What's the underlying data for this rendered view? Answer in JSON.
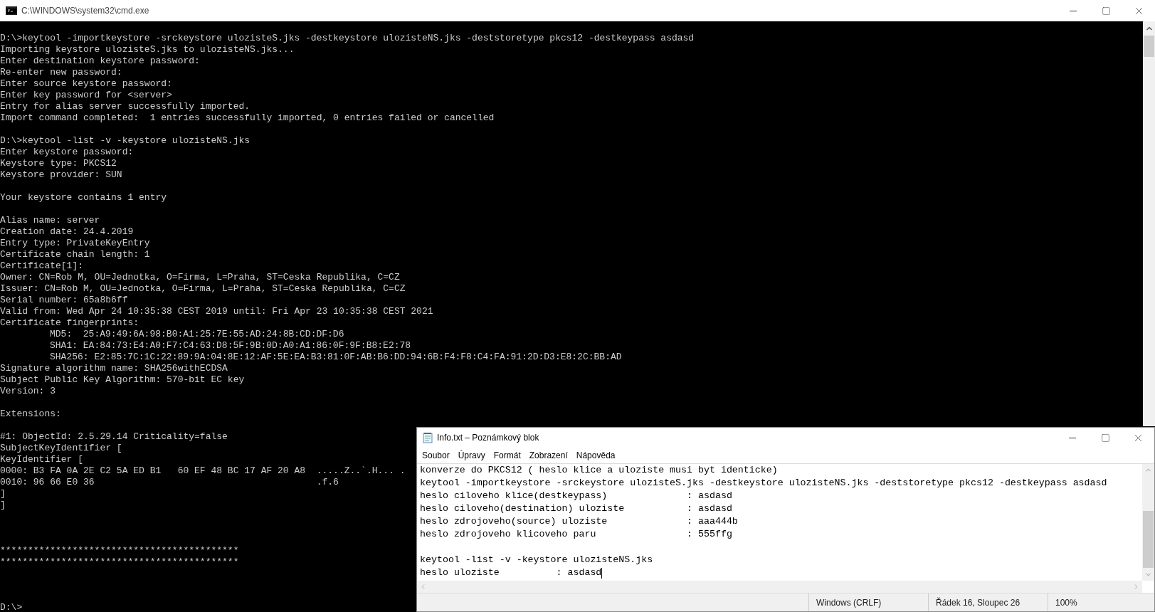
{
  "cmd": {
    "title": "C:\\WINDOWS\\system32\\cmd.exe",
    "blocks": [
      {
        "kind": "normal",
        "lines": [
          {
            "text": "D:\\>keytool -importkeystore -srckeystore ulozisteS.jks -destkeystore ulozisteNS.jks -deststoretype pkcs12 -destkeypass asdasd"
          },
          {
            "text": "Importing keystore ulozisteS.jks to ulozisteNS.jks..."
          },
          {
            "text": "Enter destination keystore password:"
          },
          {
            "text": "Re-enter new password:"
          },
          {
            "text": "Enter source keystore password:"
          },
          {
            "text": "Enter key password for <server>"
          },
          {
            "text": "Entry for alias server successfully imported."
          },
          {
            "text": "Import command completed:  1 entries successfully imported, 0 entries failed or cancelled"
          }
        ]
      },
      {
        "kind": "normal",
        "lines": [
          {
            "text": "D:\\>keytool -list -v -keystore ulozisteNS.jks"
          },
          {
            "text": "Enter keystore password:"
          },
          {
            "text": "Keystore type: PKCS12"
          },
          {
            "text": "Keystore provider: SUN"
          }
        ]
      },
      {
        "kind": "normal",
        "lines": [
          {
            "text": "Your keystore contains 1 entry"
          }
        ]
      },
      {
        "kind": "normal",
        "lines": [
          {
            "text": "Alias name: server"
          },
          {
            "text": "Creation date: 24.4.2019"
          },
          {
            "text": "Entry type: PrivateKeyEntry"
          },
          {
            "text": "Certificate chain length: 1"
          },
          {
            "text": "Certificate[1]:"
          },
          {
            "text": "Owner: CN=Rob M, OU=Jednotka, O=Firma, L=Praha, ST=Ceska Republika, C=CZ"
          },
          {
            "text": "Issuer: CN=Rob M, OU=Jednotka, O=Firma, L=Praha, ST=Ceska Republika, C=CZ"
          },
          {
            "text": "Serial number: 65a8b6ff"
          },
          {
            "text": "Valid from: Wed Apr 24 10:35:38 CEST 2019 until: Fri Apr 23 10:35:38 CEST 2021"
          },
          {
            "text": "Certificate fingerprints:",
            "children": [
              {
                "text": "MD5:  25:A9:49:6A:98:B0:A1:25:7E:55:AD:24:8B:CD:DF:D6"
              },
              {
                "text": "SHA1: EA:84:73:E4:A0:F7:C4:63:D8:5F:9B:0D:A0:A1:86:0F:9F:B8:E2:78"
              },
              {
                "text": "SHA256: E2:85:7C:1C:22:89:9A:04:8E:12:AF:5E:EA:B3:81:0F:AB:B6:DD:94:6B:F4:F8:C4:FA:91:2D:D3:E8:2C:BB:AD"
              }
            ]
          },
          {
            "text": "Signature algorithm name: SHA256withECDSA"
          },
          {
            "text": "Subject Public Key Algorithm: 570-bit EC key"
          },
          {
            "text": "Version: 3"
          }
        ]
      },
      {
        "kind": "normal",
        "lines": [
          {
            "text": "Extensions:"
          }
        ]
      },
      {
        "kind": "normal",
        "lines": [
          {
            "text": "#1: ObjectId: 2.5.29.14 Criticality=false"
          },
          {
            "text": "SubjectKeyIdentifier ["
          },
          {
            "text": "KeyIdentifier ["
          },
          {
            "text": "0000: B3 FA 0A 2E C2 5A ED B1   60 EF 48 BC 17 AF 20 A8  .....Z..`.H... ."
          },
          {
            "text": "0010: 96 66 E0 36                                        .f.6"
          },
          {
            "text": "]"
          },
          {
            "text": "]"
          }
        ]
      },
      {
        "kind": "wide",
        "lines": [
          {
            "text": "*******************************************"
          },
          {
            "text": "*******************************************"
          }
        ]
      },
      {
        "kind": "wide",
        "lines": [
          {
            "text": "D:\\>"
          }
        ]
      }
    ]
  },
  "notepad": {
    "title": "Info.txt – Poznámkový blok",
    "menu": [
      "Soubor",
      "Úpravy",
      "Formát",
      "Zobrazení",
      "Nápověda"
    ],
    "lines": [
      {
        "text": "konverze do PKCS12 ( heslo klice a uloziste musi byt identicke)",
        "caret": false
      },
      {
        "text": "keytool -importkeystore -srckeystore ulozisteS.jks -destkeystore ulozisteNS.jks -deststoretype pkcs12 -destkeypass asdasd",
        "caret": false
      },
      {
        "text": "heslo ciloveho klice(destkeypass)              : asdasd",
        "caret": false
      },
      {
        "text": "heslo ciloveho(destination) uloziste           : asdasd",
        "caret": false
      },
      {
        "text": "heslo zdrojoveho(source) uloziste              : aaa444b",
        "caret": false
      },
      {
        "text": "heslo zdrojoveho klicoveho paru                : 555ffg",
        "caret": false
      },
      {
        "text": "keytool -list -v -keystore ulozisteNS.jks",
        "caret": false,
        "kind": "spaced"
      },
      {
        "text": "heslo uloziste          : asdasd",
        "caret": true
      }
    ],
    "status": [
      "Windows (CRLF)",
      "Řádek 16, Sloupec 26",
      "100%"
    ]
  }
}
